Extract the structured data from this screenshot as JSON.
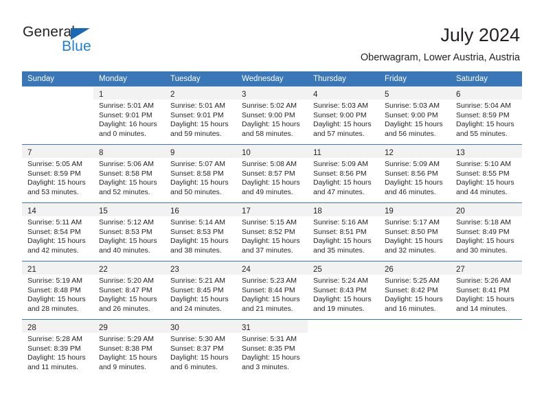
{
  "brand": {
    "name_part1": "General",
    "name_part2": "Blue",
    "triangle_color": "#1b69b4",
    "blue_color": "#1b7fd4"
  },
  "header": {
    "title": "July 2024",
    "subtitle": "Oberwagram, Lower Austria, Austria",
    "header_bg": "#3a77b8",
    "band_bg": "#f2f2f2"
  },
  "weekdays": [
    "Sunday",
    "Monday",
    "Tuesday",
    "Wednesday",
    "Thursday",
    "Friday",
    "Saturday"
  ],
  "weeks": [
    [
      {
        "day": "",
        "sunrise": "",
        "sunset": "",
        "daylight1": "",
        "daylight2": ""
      },
      {
        "day": "1",
        "sunrise": "Sunrise: 5:01 AM",
        "sunset": "Sunset: 9:01 PM",
        "daylight1": "Daylight: 16 hours",
        "daylight2": "and 0 minutes."
      },
      {
        "day": "2",
        "sunrise": "Sunrise: 5:01 AM",
        "sunset": "Sunset: 9:01 PM",
        "daylight1": "Daylight: 15 hours",
        "daylight2": "and 59 minutes."
      },
      {
        "day": "3",
        "sunrise": "Sunrise: 5:02 AM",
        "sunset": "Sunset: 9:00 PM",
        "daylight1": "Daylight: 15 hours",
        "daylight2": "and 58 minutes."
      },
      {
        "day": "4",
        "sunrise": "Sunrise: 5:03 AM",
        "sunset": "Sunset: 9:00 PM",
        "daylight1": "Daylight: 15 hours",
        "daylight2": "and 57 minutes."
      },
      {
        "day": "5",
        "sunrise": "Sunrise: 5:03 AM",
        "sunset": "Sunset: 9:00 PM",
        "daylight1": "Daylight: 15 hours",
        "daylight2": "and 56 minutes."
      },
      {
        "day": "6",
        "sunrise": "Sunrise: 5:04 AM",
        "sunset": "Sunset: 8:59 PM",
        "daylight1": "Daylight: 15 hours",
        "daylight2": "and 55 minutes."
      }
    ],
    [
      {
        "day": "7",
        "sunrise": "Sunrise: 5:05 AM",
        "sunset": "Sunset: 8:59 PM",
        "daylight1": "Daylight: 15 hours",
        "daylight2": "and 53 minutes."
      },
      {
        "day": "8",
        "sunrise": "Sunrise: 5:06 AM",
        "sunset": "Sunset: 8:58 PM",
        "daylight1": "Daylight: 15 hours",
        "daylight2": "and 52 minutes."
      },
      {
        "day": "9",
        "sunrise": "Sunrise: 5:07 AM",
        "sunset": "Sunset: 8:58 PM",
        "daylight1": "Daylight: 15 hours",
        "daylight2": "and 50 minutes."
      },
      {
        "day": "10",
        "sunrise": "Sunrise: 5:08 AM",
        "sunset": "Sunset: 8:57 PM",
        "daylight1": "Daylight: 15 hours",
        "daylight2": "and 49 minutes."
      },
      {
        "day": "11",
        "sunrise": "Sunrise: 5:09 AM",
        "sunset": "Sunset: 8:56 PM",
        "daylight1": "Daylight: 15 hours",
        "daylight2": "and 47 minutes."
      },
      {
        "day": "12",
        "sunrise": "Sunrise: 5:09 AM",
        "sunset": "Sunset: 8:56 PM",
        "daylight1": "Daylight: 15 hours",
        "daylight2": "and 46 minutes."
      },
      {
        "day": "13",
        "sunrise": "Sunrise: 5:10 AM",
        "sunset": "Sunset: 8:55 PM",
        "daylight1": "Daylight: 15 hours",
        "daylight2": "and 44 minutes."
      }
    ],
    [
      {
        "day": "14",
        "sunrise": "Sunrise: 5:11 AM",
        "sunset": "Sunset: 8:54 PM",
        "daylight1": "Daylight: 15 hours",
        "daylight2": "and 42 minutes."
      },
      {
        "day": "15",
        "sunrise": "Sunrise: 5:12 AM",
        "sunset": "Sunset: 8:53 PM",
        "daylight1": "Daylight: 15 hours",
        "daylight2": "and 40 minutes."
      },
      {
        "day": "16",
        "sunrise": "Sunrise: 5:14 AM",
        "sunset": "Sunset: 8:53 PM",
        "daylight1": "Daylight: 15 hours",
        "daylight2": "and 38 minutes."
      },
      {
        "day": "17",
        "sunrise": "Sunrise: 5:15 AM",
        "sunset": "Sunset: 8:52 PM",
        "daylight1": "Daylight: 15 hours",
        "daylight2": "and 37 minutes."
      },
      {
        "day": "18",
        "sunrise": "Sunrise: 5:16 AM",
        "sunset": "Sunset: 8:51 PM",
        "daylight1": "Daylight: 15 hours",
        "daylight2": "and 35 minutes."
      },
      {
        "day": "19",
        "sunrise": "Sunrise: 5:17 AM",
        "sunset": "Sunset: 8:50 PM",
        "daylight1": "Daylight: 15 hours",
        "daylight2": "and 32 minutes."
      },
      {
        "day": "20",
        "sunrise": "Sunrise: 5:18 AM",
        "sunset": "Sunset: 8:49 PM",
        "daylight1": "Daylight: 15 hours",
        "daylight2": "and 30 minutes."
      }
    ],
    [
      {
        "day": "21",
        "sunrise": "Sunrise: 5:19 AM",
        "sunset": "Sunset: 8:48 PM",
        "daylight1": "Daylight: 15 hours",
        "daylight2": "and 28 minutes."
      },
      {
        "day": "22",
        "sunrise": "Sunrise: 5:20 AM",
        "sunset": "Sunset: 8:47 PM",
        "daylight1": "Daylight: 15 hours",
        "daylight2": "and 26 minutes."
      },
      {
        "day": "23",
        "sunrise": "Sunrise: 5:21 AM",
        "sunset": "Sunset: 8:45 PM",
        "daylight1": "Daylight: 15 hours",
        "daylight2": "and 24 minutes."
      },
      {
        "day": "24",
        "sunrise": "Sunrise: 5:23 AM",
        "sunset": "Sunset: 8:44 PM",
        "daylight1": "Daylight: 15 hours",
        "daylight2": "and 21 minutes."
      },
      {
        "day": "25",
        "sunrise": "Sunrise: 5:24 AM",
        "sunset": "Sunset: 8:43 PM",
        "daylight1": "Daylight: 15 hours",
        "daylight2": "and 19 minutes."
      },
      {
        "day": "26",
        "sunrise": "Sunrise: 5:25 AM",
        "sunset": "Sunset: 8:42 PM",
        "daylight1": "Daylight: 15 hours",
        "daylight2": "and 16 minutes."
      },
      {
        "day": "27",
        "sunrise": "Sunrise: 5:26 AM",
        "sunset": "Sunset: 8:41 PM",
        "daylight1": "Daylight: 15 hours",
        "daylight2": "and 14 minutes."
      }
    ],
    [
      {
        "day": "28",
        "sunrise": "Sunrise: 5:28 AM",
        "sunset": "Sunset: 8:39 PM",
        "daylight1": "Daylight: 15 hours",
        "daylight2": "and 11 minutes."
      },
      {
        "day": "29",
        "sunrise": "Sunrise: 5:29 AM",
        "sunset": "Sunset: 8:38 PM",
        "daylight1": "Daylight: 15 hours",
        "daylight2": "and 9 minutes."
      },
      {
        "day": "30",
        "sunrise": "Sunrise: 5:30 AM",
        "sunset": "Sunset: 8:37 PM",
        "daylight1": "Daylight: 15 hours",
        "daylight2": "and 6 minutes."
      },
      {
        "day": "31",
        "sunrise": "Sunrise: 5:31 AM",
        "sunset": "Sunset: 8:35 PM",
        "daylight1": "Daylight: 15 hours",
        "daylight2": "and 3 minutes."
      },
      {
        "day": "",
        "sunrise": "",
        "sunset": "",
        "daylight1": "",
        "daylight2": ""
      },
      {
        "day": "",
        "sunrise": "",
        "sunset": "",
        "daylight1": "",
        "daylight2": ""
      },
      {
        "day": "",
        "sunrise": "",
        "sunset": "",
        "daylight1": "",
        "daylight2": ""
      }
    ]
  ]
}
